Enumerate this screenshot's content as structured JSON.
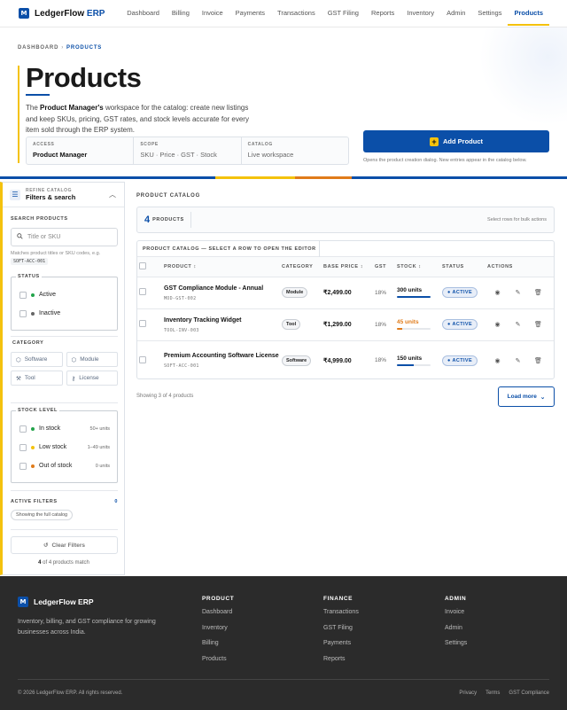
{
  "brand": {
    "name": "LedgerFlow",
    "accent": "ERP",
    "full": "LedgerFlow ERP",
    "mark": "M",
    "color": "#0b4fa8",
    "accent_color": "#f4c20d"
  },
  "nav": {
    "items": [
      "Dashboard",
      "Billing",
      "Invoice",
      "Payments",
      "Transactions",
      "GST Filing",
      "Reports",
      "Inventory",
      "Admin",
      "Settings",
      "Products"
    ],
    "active": "Products"
  },
  "breadcrumb": {
    "root": "DASHBOARD",
    "current": "PRODUCTS"
  },
  "hero": {
    "title": "Products",
    "desc_pre": "The ",
    "desc_role": "Product Manager's",
    "desc_post": " workspace for the catalog: create new listings and keep SKUs, pricing, GST rates, and stock levels accurate for every item sold through the ERP system.",
    "meta": [
      {
        "key": "ACCESS",
        "value": "Product Manager"
      },
      {
        "key": "SCOPE",
        "value": "SKU · Price · GST · Stock"
      },
      {
        "key": "CATALOG",
        "value": "Live workspace"
      }
    ],
    "add_button": "Add Product",
    "add_hint": "Opens the product creation dialog. New entries appear in the catalog below."
  },
  "sidebar": {
    "kicker": "REFINE CATALOG",
    "title": "Filters & search",
    "search_label": "SEARCH PRODUCTS",
    "search_placeholder": "Title or SKU",
    "search_hint": "Matches product titles or SKU codes, e.g.",
    "search_example": "SOFT-ACC-001",
    "status_label": "STATUS",
    "status": [
      {
        "label": "Active",
        "color": "#22a34a"
      },
      {
        "label": "Inactive",
        "color": "#666666"
      }
    ],
    "category_label": "CATEGORY",
    "categories": [
      "Software",
      "Module",
      "Tool",
      "License"
    ],
    "stock_label": "STOCK LEVEL",
    "stock": [
      {
        "label": "In stock",
        "count": "50+ units",
        "color": "#22a34a"
      },
      {
        "label": "Low stock",
        "count": "1–49 units",
        "color": "#f4c20d"
      },
      {
        "label": "Out of stock",
        "count": "0 units",
        "color": "#e07b1a"
      }
    ],
    "active_filters_label": "ACTIVE FILTERS",
    "active_filters_count": "0",
    "active_filters_chip": "Showing the full catalog",
    "clear_button": "Clear Filters",
    "match_count": "4",
    "match_text": " of 4 products match"
  },
  "main": {
    "section_label": "PRODUCT CATALOG",
    "count": "4",
    "count_label": "PRODUCTS",
    "bulk_hint": "Select rows for bulk actions",
    "table_caption": "PRODUCT CATALOG — SELECT A ROW TO OPEN THE EDITOR",
    "columns": [
      "PRODUCT",
      "CATEGORY",
      "BASE PRICE",
      "GST",
      "STOCK",
      "STATUS",
      "ACTIONS"
    ],
    "rows": [
      {
        "name": "GST Compliance Module - Annual",
        "sku": "MOD-GST-002",
        "category": "Module",
        "price": "₹2,499.00",
        "gst": "18%",
        "stock": "300 units",
        "stock_level": 1.0,
        "stock_state": "in",
        "status": "ACTIVE"
      },
      {
        "name": "Inventory Tracking Widget",
        "sku": "TOOL-INV-003",
        "category": "Tool",
        "price": "₹1,299.00",
        "gst": "18%",
        "stock": "45 units",
        "stock_level": 0.15,
        "stock_state": "low",
        "status": "ACTIVE"
      },
      {
        "name": "Premium Accounting Software License",
        "sku": "SOFT-ACC-001",
        "category": "Software",
        "price": "₹4,999.00",
        "gst": "18%",
        "stock": "150 units",
        "stock_level": 0.5,
        "stock_state": "in",
        "status": "ACTIVE"
      }
    ],
    "showing": "Showing 3 of 4 products",
    "load_more": "Load more"
  },
  "footer": {
    "brand": "LedgerFlow ERP",
    "tagline": "Inventory, billing, and GST compliance for growing businesses across India.",
    "columns": [
      {
        "title": "PRODUCT",
        "links": [
          "Dashboard",
          "Inventory",
          "Billing",
          "Products"
        ]
      },
      {
        "title": "FINANCE",
        "links": [
          "Transactions",
          "GST Filing",
          "Payments",
          "Reports"
        ]
      },
      {
        "title": "ADMIN",
        "links": [
          "Invoice",
          "Admin",
          "Settings"
        ]
      }
    ],
    "copyright": "© 2026 LedgerFlow ERP. All rights reserved.",
    "legal": [
      "Privacy",
      "Terms",
      "GST Compliance"
    ]
  }
}
